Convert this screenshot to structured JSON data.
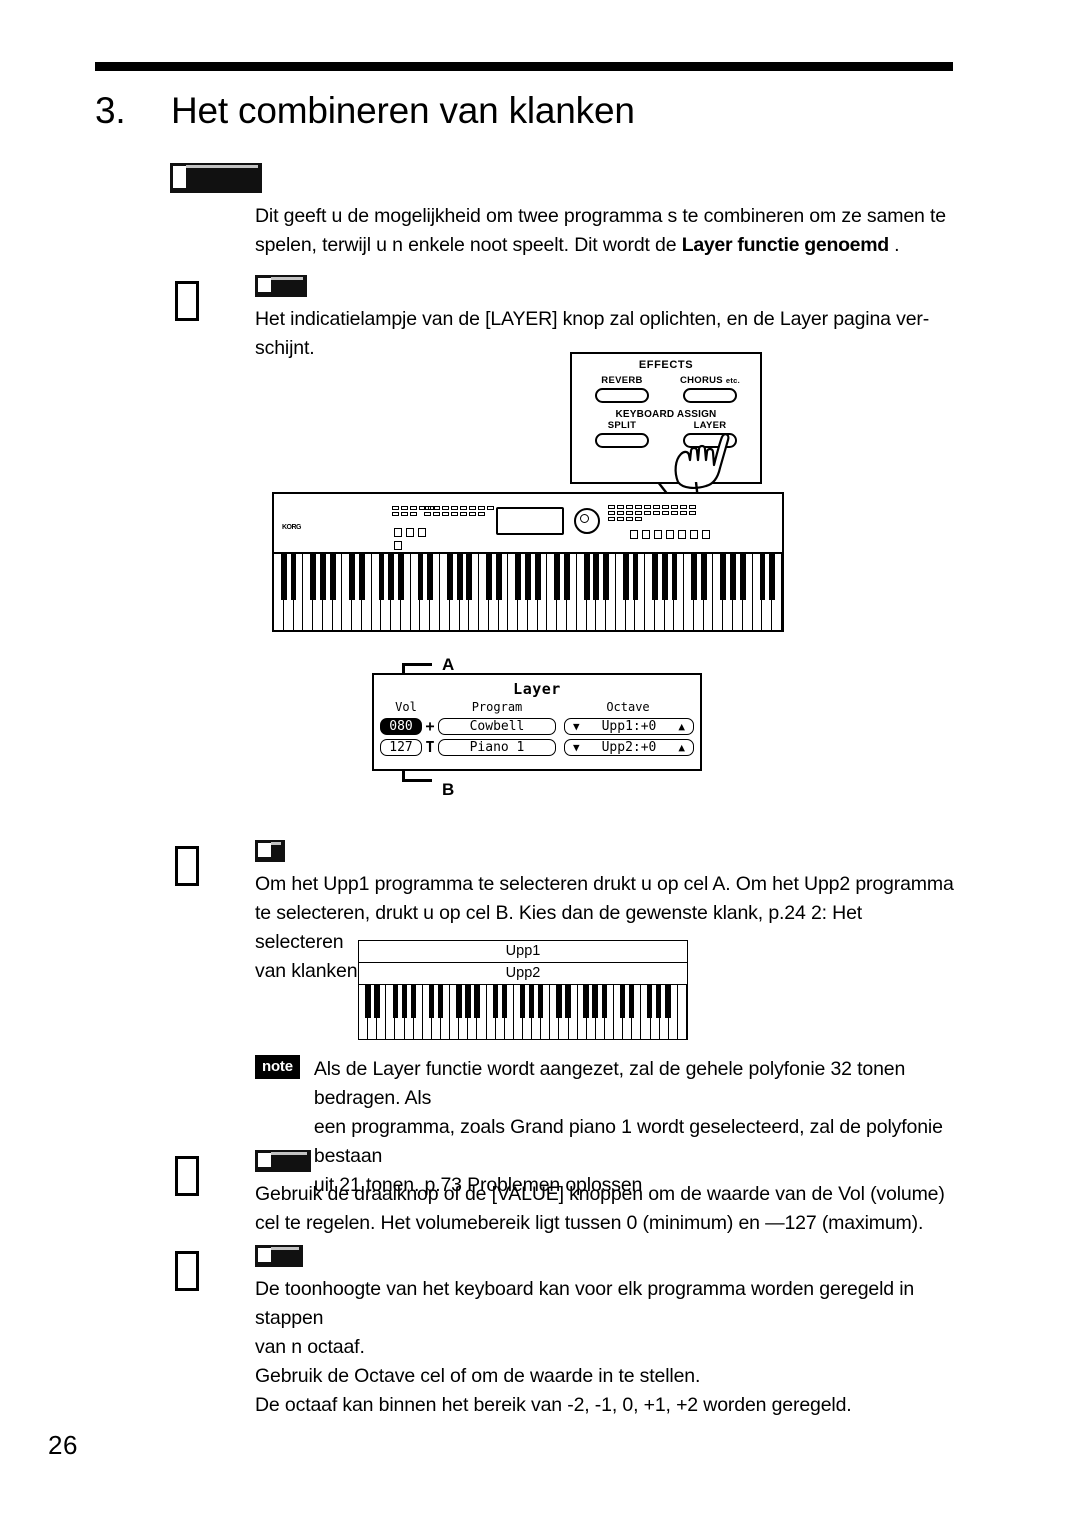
{
  "page": {
    "number": "26"
  },
  "title": {
    "number": "3.",
    "text": "Het combineren van klanken"
  },
  "intro": {
    "line1": "Dit geeft u de mogelijkheid om twee programma s te combineren om ze samen te",
    "line2_pre": "spelen, terwijl u  n enkele noot speelt. Dit wordt de ",
    "bold_term": "Layer functie genoemd",
    "line2_post": " ."
  },
  "steps": [
    {
      "body_line1": "Het indicatielampje van de [LAYER] knop zal oplichten, en de  Layer  pagina ver-",
      "body_line2": "schijnt."
    },
    {
      "body_line1": "Om het  Upp1  programma te selecteren drukt u op cel A. Om het  Upp2  programma",
      "body_line2": "te selecteren, drukt u op cel B. Kies dan de gewenste klank,   p.24  2: Het selecteren",
      "body_line3": "van klanken"
    },
    {
      "body_line1": "Gebruik de draaiknop of de [VALUE] knoppen om de waarde van de  Vol (volume)",
      "body_line2": "cel te regelen. Het volumebereik ligt tussen 0 (minimum) en —127 (maximum)."
    },
    {
      "body_line1": "De toonhoogte van het keyboard kan voor elk programma worden geregeld in stappen",
      "body_line2": "van  n octaaf.",
      "body_line3": "Gebruik de  Octave  cel        of        om de waarde in te stellen.",
      "body_line4": "De octaaf kan binnen het bereik van -2, -1, 0, +1, +2 worden geregeld."
    }
  ],
  "effects_panel": {
    "title": "EFFECTS",
    "reverb_label": "REVERB",
    "chorus_label": "CHORUS",
    "chorus_suffix": "etc.",
    "group_label": "KEYBOARD ASSIGN",
    "split_label": "SPLIT",
    "layer_label": "LAYER"
  },
  "instrument": {
    "brand": "KORG"
  },
  "lcd": {
    "title": "Layer",
    "header_vol": "Vol",
    "header_program": "Program",
    "header_octave": "Octave",
    "rows": [
      {
        "vol": "080",
        "program": "Cowbell",
        "octave": "Upp1:+0",
        "down_arrow": "▼",
        "up_arrow": "▲"
      },
      {
        "vol": "127",
        "program": "Piano 1",
        "octave": "Upp2:+0",
        "down_arrow": "▼",
        "up_arrow": "▲"
      }
    ],
    "callout_a": "A",
    "callout_b": "B"
  },
  "range_diagram": {
    "upper1": "Upp1",
    "upper2": "Upp2"
  },
  "note": {
    "badge": "note",
    "line1": "Als de Layer functie wordt aangezet, zal de gehele polyfonie 32 tonen bedragen. Als",
    "line2": "een programma, zoals  Grand piano 1  wordt geselecteerd, zal de polyfonie bestaan",
    "line3": "uit 21 tonen.     p.73  Problemen oplossen"
  }
}
